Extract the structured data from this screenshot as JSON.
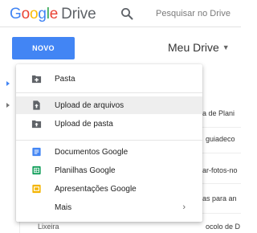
{
  "header": {
    "logo_google": "Google",
    "logo_product": "Drive",
    "search_placeholder": "Pesquisar no Drive"
  },
  "toolbar": {
    "new_label": "NOVO",
    "location_label": "Meu Drive",
    "location_caret": "▼"
  },
  "background": {
    "files": [
      "a de Plani",
      "guiadeco",
      "ar-fotos-no",
      "as para an",
      "ocolo de D"
    ],
    "bottom_item": "Lixeira"
  },
  "menu": {
    "items": [
      {
        "label": "Pasta",
        "icon": "folder-plus-icon",
        "highlighted": false
      },
      {
        "label": "Upload de arquivos",
        "icon": "file-upload-icon",
        "highlighted": true
      },
      {
        "label": "Upload de pasta",
        "icon": "folder-upload-icon",
        "highlighted": false
      },
      {
        "label": "Documentos Google",
        "icon": "google-docs-icon",
        "color": "#4285f4"
      },
      {
        "label": "Planilhas Google",
        "icon": "google-sheets-icon",
        "color": "#0f9d58"
      },
      {
        "label": "Apresentações Google",
        "icon": "google-slides-icon",
        "color": "#f4b400"
      },
      {
        "label": "Mais",
        "icon": "",
        "submenu": true
      }
    ],
    "submenu_chevron": "›"
  },
  "colors": {
    "accent": "#4285f4",
    "google_blue": "#4285f4",
    "google_red": "#ea4335",
    "google_yellow": "#fbbc05",
    "google_green": "#34a853"
  }
}
